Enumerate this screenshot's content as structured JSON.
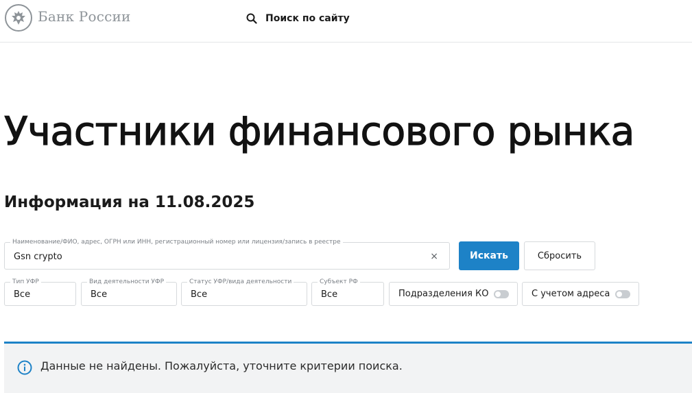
{
  "header": {
    "logo_text": "Банк России",
    "search_label": "Поиск по сайту"
  },
  "page_title": "Участники финансового рынка",
  "info_date": "Информация на 11.08.2025",
  "search": {
    "label": "Наименование/ФИО, адрес, ОГРН или ИНН, регистрационный номер или лицензия/запись в реестре",
    "value": "Gsn crypto",
    "clear_symbol": "×",
    "submit_label": "Искать",
    "reset_label": "Сбросить"
  },
  "filters": [
    {
      "label": "Тип УФР",
      "value": "Все"
    },
    {
      "label": "Вид деятельности УФР",
      "value": "Все"
    },
    {
      "label": "Статус УФР/вида деятельности",
      "value": "Все"
    },
    {
      "label": "Субъект РФ",
      "value": "Все"
    }
  ],
  "toggles": [
    {
      "label": "Подразделения КО",
      "on": false
    },
    {
      "label": "С учетом адреса",
      "on": false
    }
  ],
  "notice": {
    "text": "Данные не найдены. Пожалуйста, уточните критерии поиска.",
    "icon": "info-icon"
  },
  "colors": {
    "accent": "#1d82c7",
    "notice_bg": "#f2f3f4",
    "logo_gray": "#8e9499"
  }
}
